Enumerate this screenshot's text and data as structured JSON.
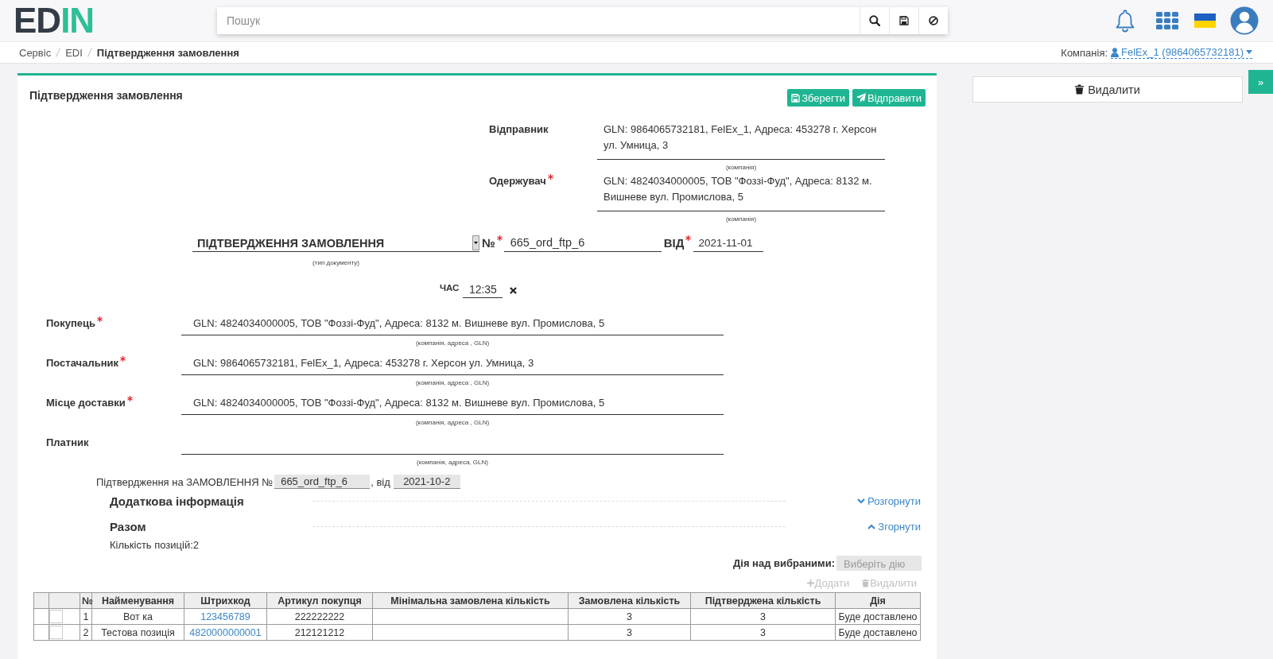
{
  "header": {
    "logo": {
      "text": "ED",
      "accent": "IN"
    },
    "search": {
      "placeholder": "Пошук"
    }
  },
  "breadcrumbs": [
    {
      "label": "Сервіс",
      "current": false
    },
    {
      "label": "EDI",
      "current": false
    },
    {
      "label": "Підтвердження замовлення",
      "current": true
    }
  ],
  "company": {
    "label": "Компанія:",
    "value": "FelEx_1 (9864065732181)"
  },
  "document": {
    "title": "Підтвердження замовлення",
    "actions": [
      {
        "kind": "save",
        "label": "Зберегти"
      },
      {
        "kind": "send",
        "label": "Відправити"
      }
    ],
    "correspondents": [
      {
        "label": "Відправник",
        "required": false,
        "value": "GLN: 9864065732181, FelEx_1, Адреса: 453278 г. Херсон ул. Умница, 3",
        "hint": "(компанія)"
      },
      {
        "label": "Одержувач",
        "required": true,
        "value": "GLN: 4824034000005, ТОВ \"Фоззі-Фуд\", Адреса: 8132 м. Вишневе вул. Промислова, 5",
        "hint": "(компанія)"
      }
    ],
    "doc_type": {
      "value": "ПІДТВЕРДЖЕННЯ ЗАМОВЛЕННЯ",
      "hint": "(тип документу)"
    },
    "number": {
      "label": "№",
      "required": true,
      "value": "665_ord_ftp_6"
    },
    "date": {
      "label": "ВІД",
      "required": true,
      "value": "2021-11-01"
    },
    "time": {
      "label": "ЧАС",
      "value": "12:35"
    },
    "parties": [
      {
        "label": "Покупець",
        "required": true,
        "value": "GLN: 4824034000005, ТОВ \"Фоззі-Фуд\", Адреса: 8132 м. Вишневе вул. Промислова, 5",
        "hint": "(компанія, адреса , GLN)"
      },
      {
        "label": "Постачальник",
        "required": true,
        "value": "GLN: 9864065732181, FelEx_1, Адреса: 453278 г. Херсон ул. Умница, 3",
        "hint": "(компанія, адреса , GLN)"
      },
      {
        "label": "Місце доставки",
        "required": true,
        "value": "GLN: 4824034000005, ТОВ \"Фоззі-Фуд\", Адреса: 8132 м. Вишневе вул. Промислова, 5",
        "hint": "(компанія, адреса , GLN)"
      },
      {
        "label": "Платник",
        "required": false,
        "hint": "(компанія, адреса, GLN)"
      }
    ],
    "reference": {
      "text": "Підтвердження на ЗАМОВЛЕННЯ №",
      "number": "665_ord_ftp_6",
      "date_label": ", від",
      "date": "2021-10-2",
      "disabled": true
    },
    "sections": [
      {
        "title": "Додаткова інформація",
        "expanded": false,
        "toggle": "Розгорнути"
      },
      {
        "title": "Разом",
        "expanded": true,
        "toggle": "Згорнути",
        "summary": "Кількість позицій:2"
      }
    ],
    "bulk_action": {
      "label": "Дія над вибраними:",
      "placeholder": "Виберіть дію",
      "disabled": true
    },
    "row_actions": [
      {
        "kind": "add",
        "label": "Додати",
        "disabled": true
      },
      {
        "kind": "delete",
        "label": "Видалити",
        "disabled": true
      }
    ],
    "table": {
      "columns": [
        "№",
        "Найменування",
        "Штрихкод",
        "Артикул покупця",
        "Мінімальна замовлена кількість",
        "Замовлена кількість",
        "Підтверджена кількість",
        "Дія"
      ],
      "rows": [
        {
          "checked": false,
          "no": "1",
          "name": "Вот ка",
          "barcode": "123456789",
          "buyer_article": "222222222",
          "ordered": "3",
          "confirmed": "3",
          "action": "Буде доставлено"
        },
        {
          "checked": false,
          "no": "2",
          "name": "Тестова позиція",
          "barcode": "4820000000001",
          "buyer_article": "212121212",
          "ordered": "3",
          "confirmed": "3",
          "action": "Буде доставлено"
        }
      ]
    }
  },
  "side_panel": {
    "delete": "Видалити",
    "toggle": "»"
  }
}
